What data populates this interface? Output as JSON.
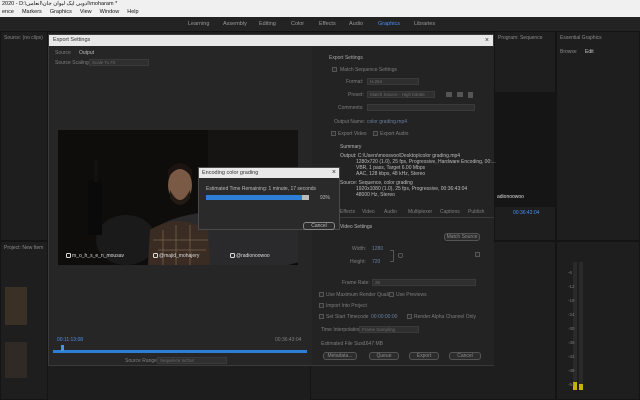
{
  "app": {
    "title": "2020 - D:\\ادوبی ایک لیوان جان\\انعامی\\moharam *",
    "menu": [
      "ence",
      "Markers",
      "Graphics",
      "View",
      "Window",
      "Help"
    ]
  },
  "workspaces": [
    "Learning",
    "Assembly",
    "Editing",
    "Color",
    "Effects",
    "Audio",
    "Graphics",
    "Libraries"
  ],
  "active_workspace": "Graphics",
  "panels": {
    "left_top_label": "Source: (no clips)",
    "program_label": "Program: Sequence",
    "right_tabs": [
      "Essential Graphics",
      "Browse",
      "Edit"
    ],
    "project_label": "Project: New Item"
  },
  "export_dialog": {
    "title": "Export Settings",
    "close": "×",
    "left_tabs": [
      "Source",
      "Output"
    ],
    "source_scaling_label": "Source Scaling:",
    "source_scaling_value": "Scale To Fit",
    "export_settings_heading": "Export Settings",
    "match_sequence": "Match Sequence Settings",
    "format_label": "Format:",
    "format_value": "H.264",
    "preset_label": "Preset:",
    "preset_value": "Match Source - High bitrate",
    "comments_label": "Comments:",
    "output_name_label": "Output Name:",
    "output_name_value": "color grading.mp4",
    "export_video": "Export Video",
    "export_audio": "Export Audio",
    "summary_heading": "Summary",
    "output_summary": [
      "Output: C:\\Users\\moosvoo\\Desktop\\color grading.mp4",
      "1280x720 (1.0), 25 fps, Progressive, Hardware Encoding, 00:...",
      "VBR, 1 pass, Target 6.00 Mbps",
      "AAC, 128 kbps, 48 kHz, Stereo"
    ],
    "source_summary": [
      "Source: Sequence, color grading",
      "1920x1080 (1.0), 25 fps, Progressive, 00:36:43:04",
      "48000 Hz, Stereo"
    ],
    "lower_tabs": [
      "Effects",
      "Video",
      "Audio",
      "Multiplexer",
      "Captions",
      "Publish"
    ],
    "video_settings_heading": "Video Settings",
    "match_source_button": "Match Source",
    "width_label": "Width:",
    "width_value": "1280",
    "height_label": "Height:",
    "height_value": "720",
    "frame_rate_label": "Frame Rate:",
    "frame_rate_value": "25",
    "use_max_render": "Use Maximum Render Quality",
    "use_previews": "Use Previews",
    "import_into_project": "Import Into Project",
    "set_start_timecode": "Set Start Timecode",
    "timecode_value": "00:00:00:00",
    "render_alpha": "Render Alpha Channel Only",
    "time_interpolation_label": "Time Interpolation:",
    "time_interpolation_value": "Frame Sampling",
    "file_size_label": "Estimated File Size:",
    "file_size_value": "1647 MB",
    "buttons": [
      "Metadata...",
      "Queue",
      "Export",
      "Cancel"
    ],
    "timecode_left": "00:11:13:08",
    "timecode_right": "00:36:43:04",
    "source_range_label": "Source Range:",
    "source_range_value": "Sequence In/Out"
  },
  "encoding_dialog": {
    "title": "Encoding color grading",
    "close": "×",
    "message": "Estimated Time Remaining: 1 minute, 17 seconds",
    "percent_text": "93%",
    "progress": 0.93,
    "cancel_label": "Cancel"
  },
  "video": {
    "watermarks": [
      "m_o_h_s_e_n_mousav",
      "@majid_mohajery",
      "@radionoowoo"
    ],
    "right_watermark": "adionoowoo",
    "right_timecode": "00:36:43:04"
  },
  "meter_ticks": [
    "-6",
    "-12",
    "-18",
    "-24",
    "-30",
    "-36",
    "-42",
    "-48",
    "-54"
  ],
  "colors": {
    "accent": "#4d8ef0",
    "progress": "#2d7ed6",
    "meter": "#c8b400"
  }
}
